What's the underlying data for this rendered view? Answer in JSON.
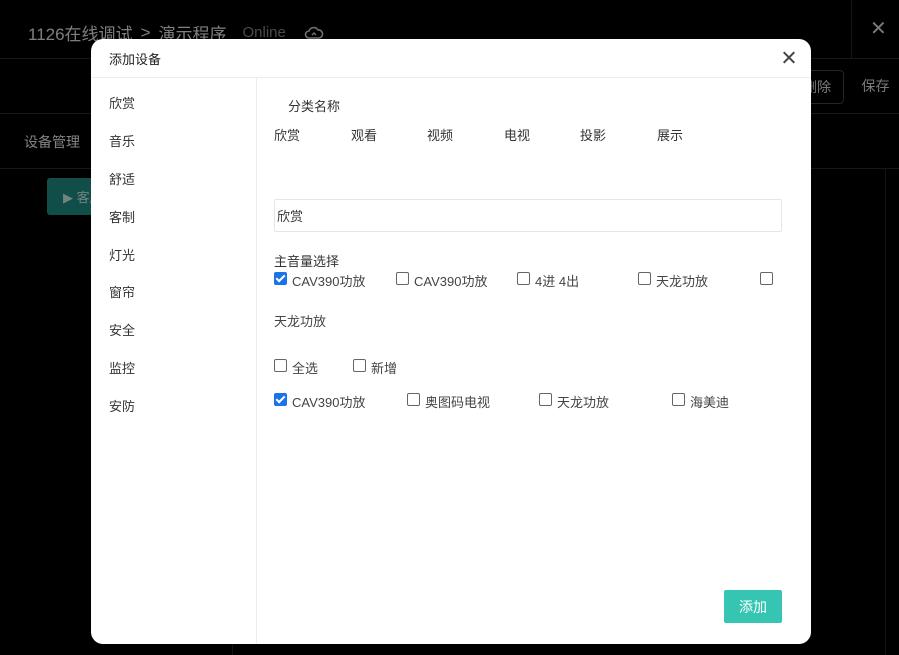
{
  "background": {
    "breadcrumb": {
      "project": "1126在线调试",
      "separator": ">",
      "app": "演示程序",
      "status": "Online"
    },
    "icons": {
      "cloud": "cloud-sync-icon",
      "close": "close-icon"
    },
    "close_label": "✕",
    "toolbar": {
      "delete_label": "删除",
      "save_label": "保存"
    },
    "tab": "设备管理",
    "green_button": "▶ 客厅"
  },
  "modal": {
    "title": "添加设备",
    "sidebar": [
      {
        "label": "欣赏"
      },
      {
        "label": "音乐"
      },
      {
        "label": "舒适"
      },
      {
        "label": "客制"
      },
      {
        "label": "灯光"
      },
      {
        "label": "窗帘"
      },
      {
        "label": "安全"
      },
      {
        "label": "监控"
      },
      {
        "label": "安防"
      }
    ],
    "category_title": "分类名称",
    "categories": [
      {
        "label": "欣赏"
      },
      {
        "label": "观看"
      },
      {
        "label": "视频"
      },
      {
        "label": "电视"
      },
      {
        "label": "投影"
      },
      {
        "label": "展示"
      }
    ],
    "name_input_value": "欣赏",
    "volume_title": "主音量选择",
    "volume_options": [
      {
        "label": "CAV390功放",
        "checked": true
      },
      {
        "label": "CAV390功放",
        "checked": false
      },
      {
        "label": "4进 4出",
        "checked": false
      },
      {
        "label": "天龙功放",
        "checked": false
      },
      {
        "label": "天龙功放",
        "checked": false
      }
    ],
    "select_all_label": "全选",
    "new_label": "新增",
    "device_options": [
      {
        "label": "CAV390功放",
        "checked": true
      },
      {
        "label": "奥图码电视",
        "checked": false
      },
      {
        "label": "天龙功放",
        "checked": false
      },
      {
        "label": "海美迪",
        "checked": false
      }
    ],
    "add_button": "添加",
    "accent_color": "#37c5b3",
    "checkbox_color": "#1a73e8"
  }
}
